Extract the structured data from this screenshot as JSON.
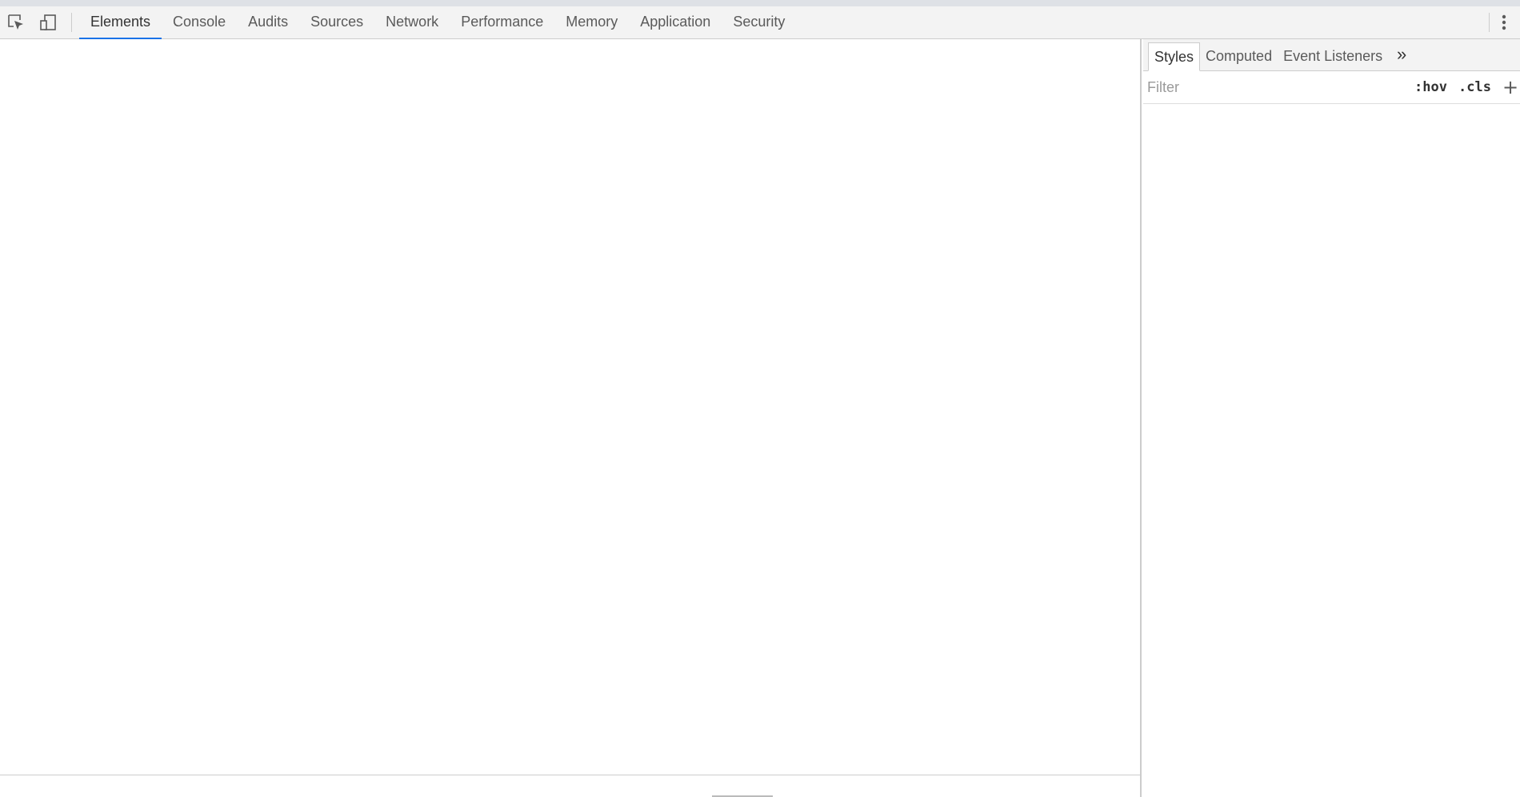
{
  "toolbar": {
    "inspect_icon": "inspect-element-icon",
    "device_icon": "device-toolbar-icon",
    "menu_icon": "vertical-dots-icon",
    "tabs": [
      {
        "label": "Elements",
        "active": true
      },
      {
        "label": "Console",
        "active": false
      },
      {
        "label": "Audits",
        "active": false
      },
      {
        "label": "Sources",
        "active": false
      },
      {
        "label": "Network",
        "active": false
      },
      {
        "label": "Performance",
        "active": false
      },
      {
        "label": "Memory",
        "active": false
      },
      {
        "label": "Application",
        "active": false
      },
      {
        "label": "Security",
        "active": false
      }
    ]
  },
  "sidebar": {
    "tabs": [
      {
        "label": "Styles",
        "active": true
      },
      {
        "label": "Computed",
        "active": false
      },
      {
        "label": "Event Listeners",
        "active": false
      }
    ],
    "more_label": "»",
    "filter": {
      "placeholder": "Filter",
      "value": "",
      "hov_label": ":hov",
      "cls_label": ".cls",
      "plus_label": "+"
    }
  },
  "colors": {
    "accent": "#1a73e8",
    "toolbar_bg": "#f3f3f3",
    "border": "#cccccc"
  }
}
